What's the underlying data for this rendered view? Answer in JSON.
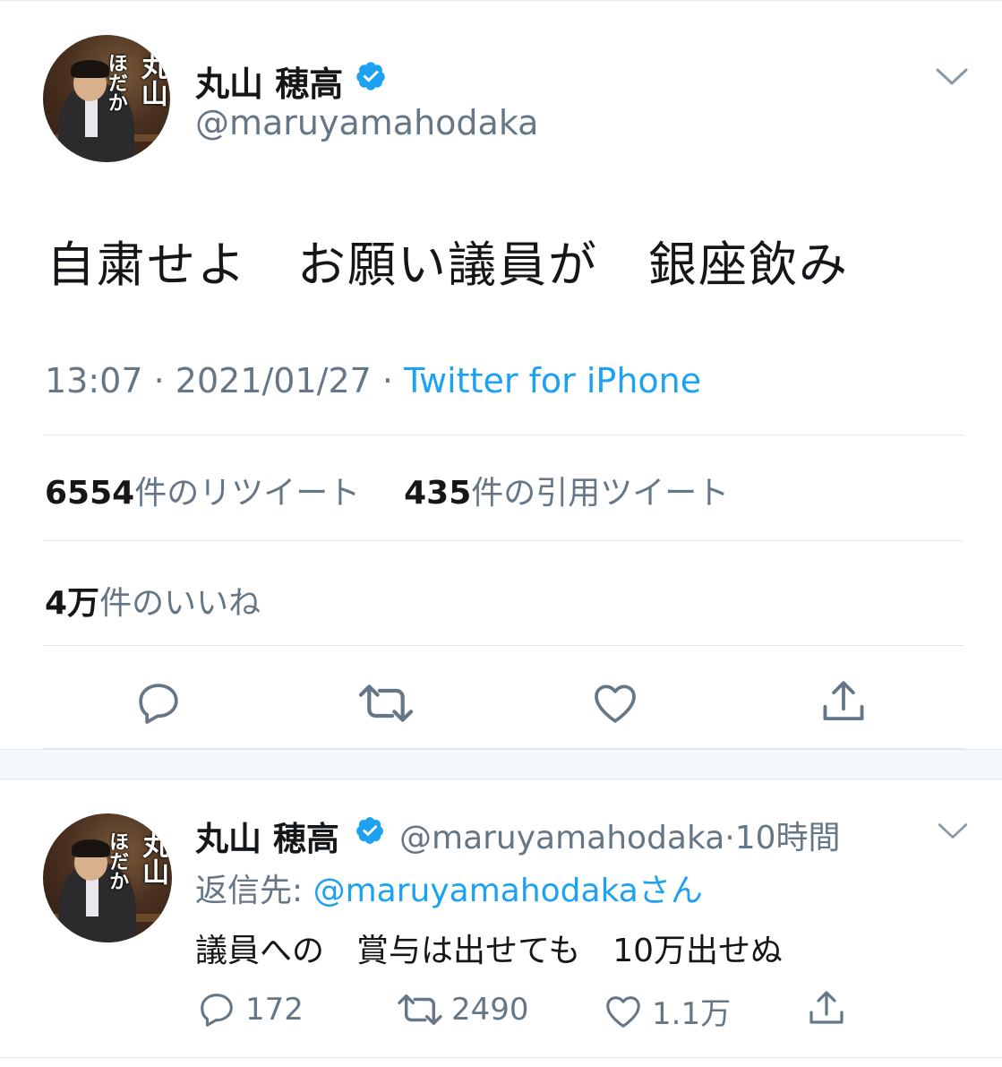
{
  "main_tweet": {
    "display_name": "丸山 穂高",
    "handle": "@maruyamahodaka",
    "avatar_banner": [
      "丸山",
      "ほだか"
    ],
    "text": "自粛せよ　お願い議員が　銀座飲み",
    "time": "13:07",
    "date": "2021/01/27",
    "separator": "·",
    "source": "Twitter for iPhone",
    "retweets_count": "6554",
    "retweets_label": "件のリツイート",
    "quotes_count": "435",
    "quotes_label": "件の引用ツイート",
    "likes_count": "4万",
    "likes_label": "件のいいね",
    "icons": [
      "reply-icon",
      "retweet-icon",
      "like-icon",
      "share-icon"
    ]
  },
  "reply_tweet": {
    "display_name": "丸山 穂高",
    "handle": "@maruyamahodaka",
    "separator": "·",
    "time_ago": "10時間",
    "reply_to_prefix": "返信先: ",
    "reply_to_handle": "@maruyamahodaka",
    "reply_to_suffix": "さん",
    "text": "議員への　賞与は出せても　10万出せぬ",
    "reply_count": "172",
    "retweet_count": "2490",
    "like_count": "1.1万",
    "icons": [
      "reply-icon",
      "retweet-icon",
      "like-icon",
      "share-icon"
    ]
  },
  "colors": {
    "accent": "#1da1f2",
    "secondary_text": "#657786",
    "primary_text": "#14171a",
    "divider": "#e1e8ed"
  }
}
